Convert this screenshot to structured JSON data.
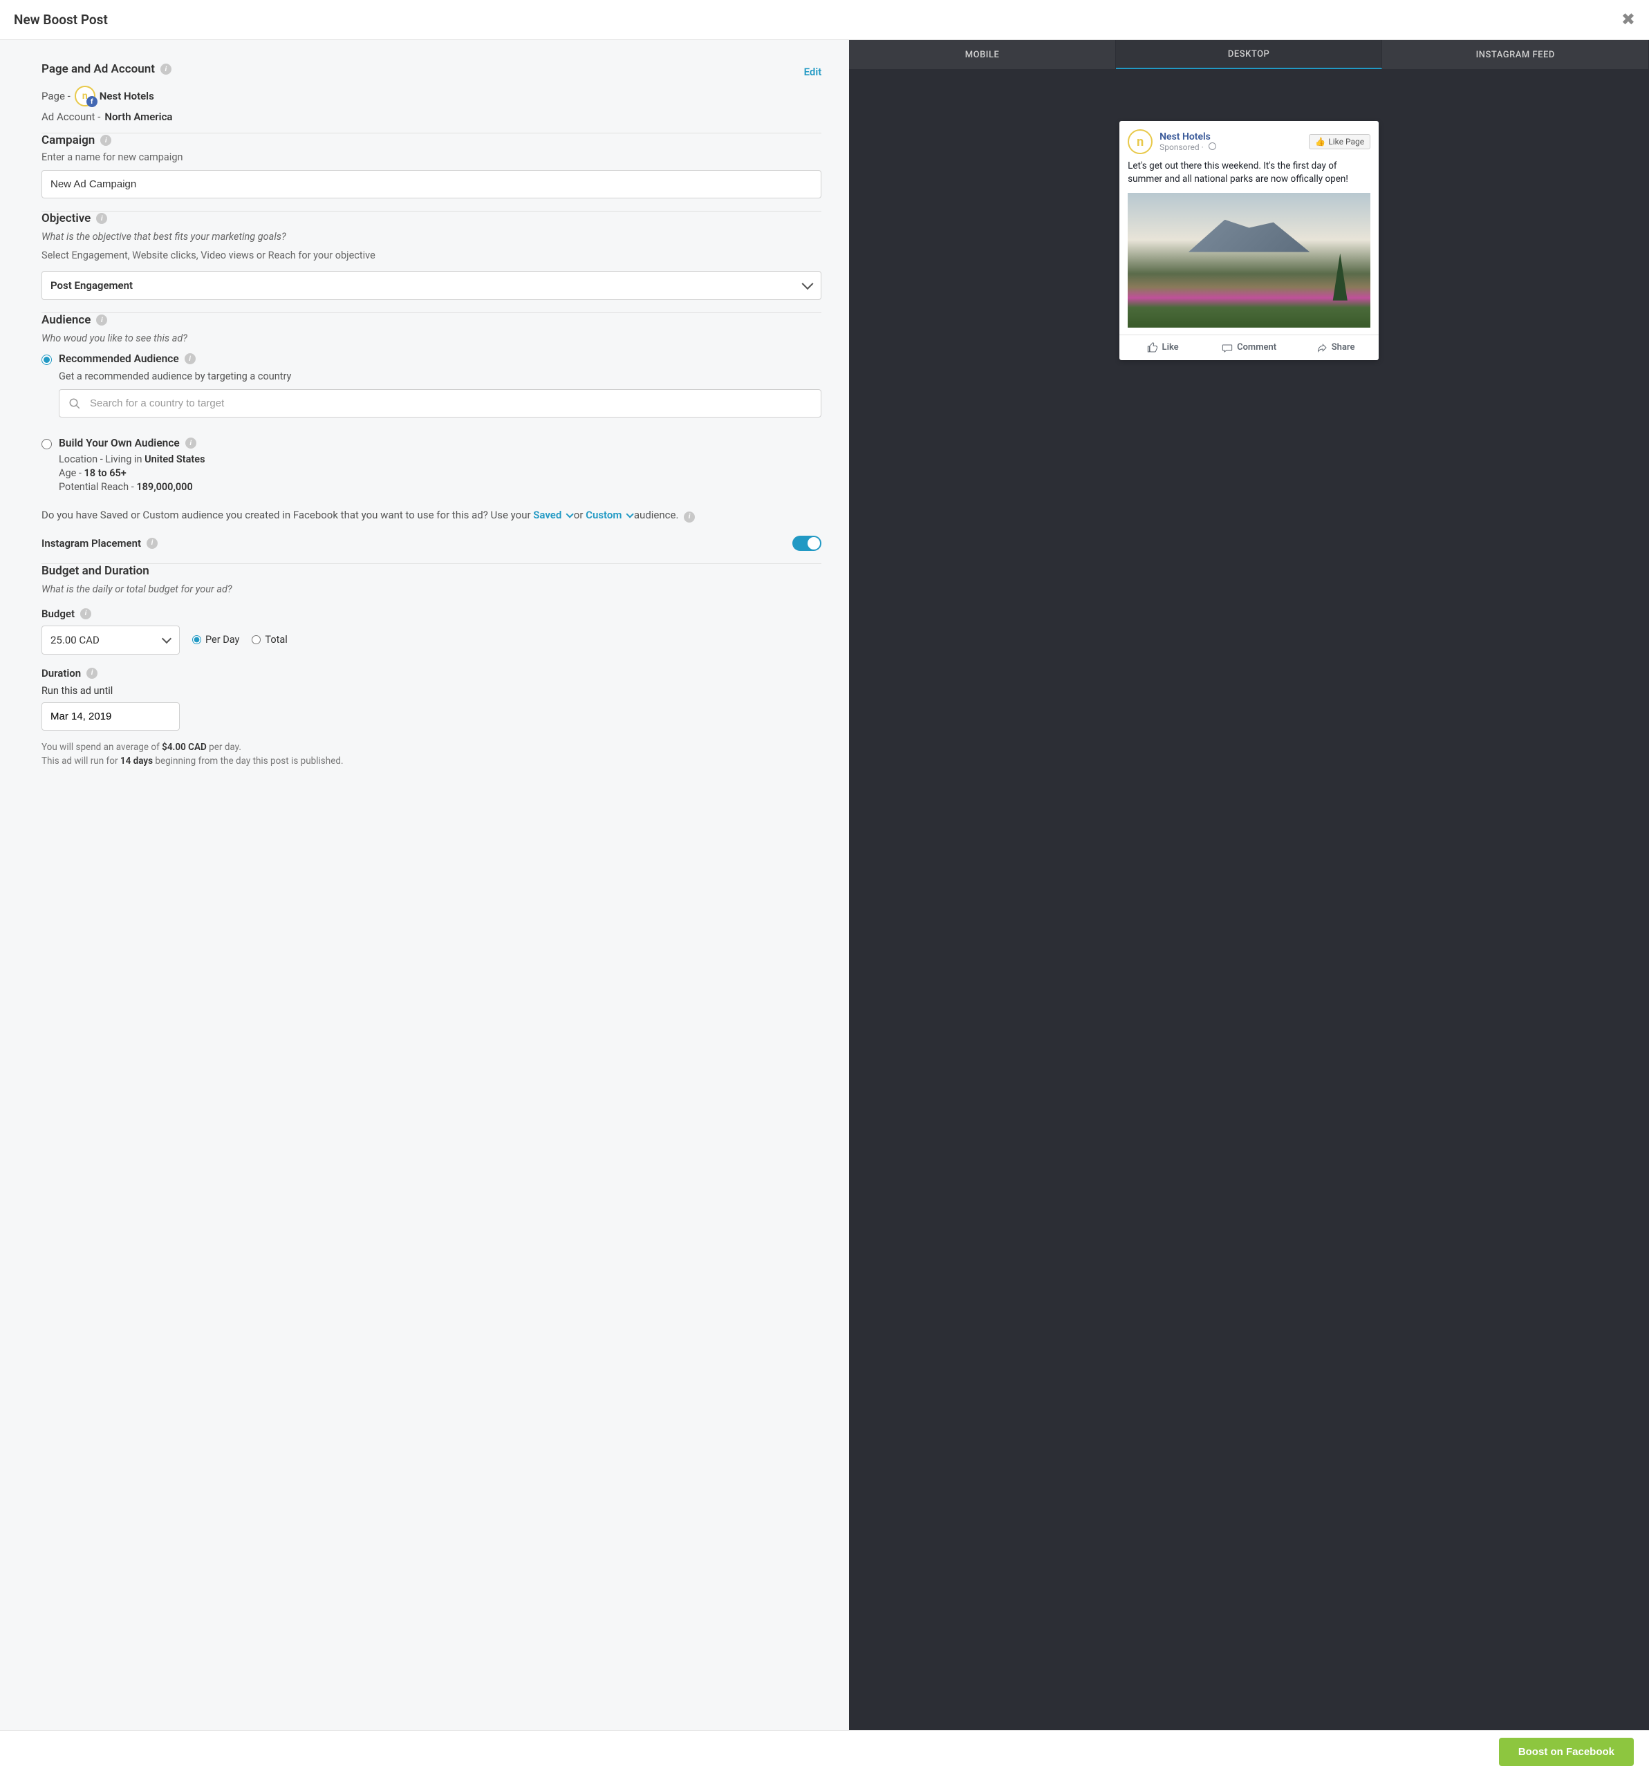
{
  "header": {
    "title": "New Boost Post"
  },
  "pageAccount": {
    "sectionTitle": "Page and Ad Account",
    "editLabel": "Edit",
    "pagePrefix": "Page -",
    "pageName": "Nest Hotels",
    "adAccountPrefix": "Ad Account -",
    "adAccountName": "North America"
  },
  "campaign": {
    "sectionTitle": "Campaign",
    "hint": "Enter a name for new campaign",
    "value": "New Ad Campaign"
  },
  "objective": {
    "sectionTitle": "Objective",
    "subtitle": "What is the objective that best fits your marketing goals?",
    "hint": "Select Engagement, Website clicks, Video views or Reach for your objective",
    "selected": "Post Engagement"
  },
  "audience": {
    "sectionTitle": "Audience",
    "subtitle": "Who woud you like to see this ad?",
    "recommended": {
      "label": "Recommended Audience",
      "desc": "Get a recommended audience by targeting a country",
      "placeholder": "Search for a country to target"
    },
    "build": {
      "label": "Build Your Own Audience",
      "locationPrefix": "Location - Living in",
      "locationValue": "United States",
      "agePrefix": "Age -",
      "ageValue": "18 to 65+",
      "reachPrefix": "Potential Reach -",
      "reachValue": "189,000,000"
    },
    "savedText1": "Do you have Saved or Custom audience you created in Facebook that you want to use for this ad? Use your ",
    "savedLink": "Saved",
    "savedOr": " or ",
    "customLink": "Custom",
    "savedText2": " audience.",
    "igLabel": "Instagram Placement"
  },
  "budget": {
    "sectionTitle": "Budget and Duration",
    "subtitle": "What is the daily or total budget for your ad?",
    "budgetLabel": "Budget",
    "amount": "25.00 CAD",
    "perDay": "Per Day",
    "total": "Total",
    "durationLabel": "Duration",
    "runUntil": "Run this ad until",
    "date": "Mar 14, 2019",
    "foot1a": "You will spend an average of ",
    "foot1b": "$4.00 CAD",
    "foot1c": " per day.",
    "foot2a": "This ad will run for ",
    "foot2b": "14 days",
    "foot2c": " beginning from the day this post is published."
  },
  "preview": {
    "tabs": {
      "mobile": "MOBILE",
      "desktop": "DESKTOP",
      "instagram": "INSTAGRAM FEED"
    },
    "name": "Nest Hotels",
    "sponsored": "Sponsored",
    "likePage": "Like Page",
    "postText": "Let's get out there this weekend. It's the first day of summer and all national parks are now offically open!",
    "like": "Like",
    "comment": "Comment",
    "share": "Share"
  },
  "footer": {
    "boost": "Boost on Facebook"
  }
}
